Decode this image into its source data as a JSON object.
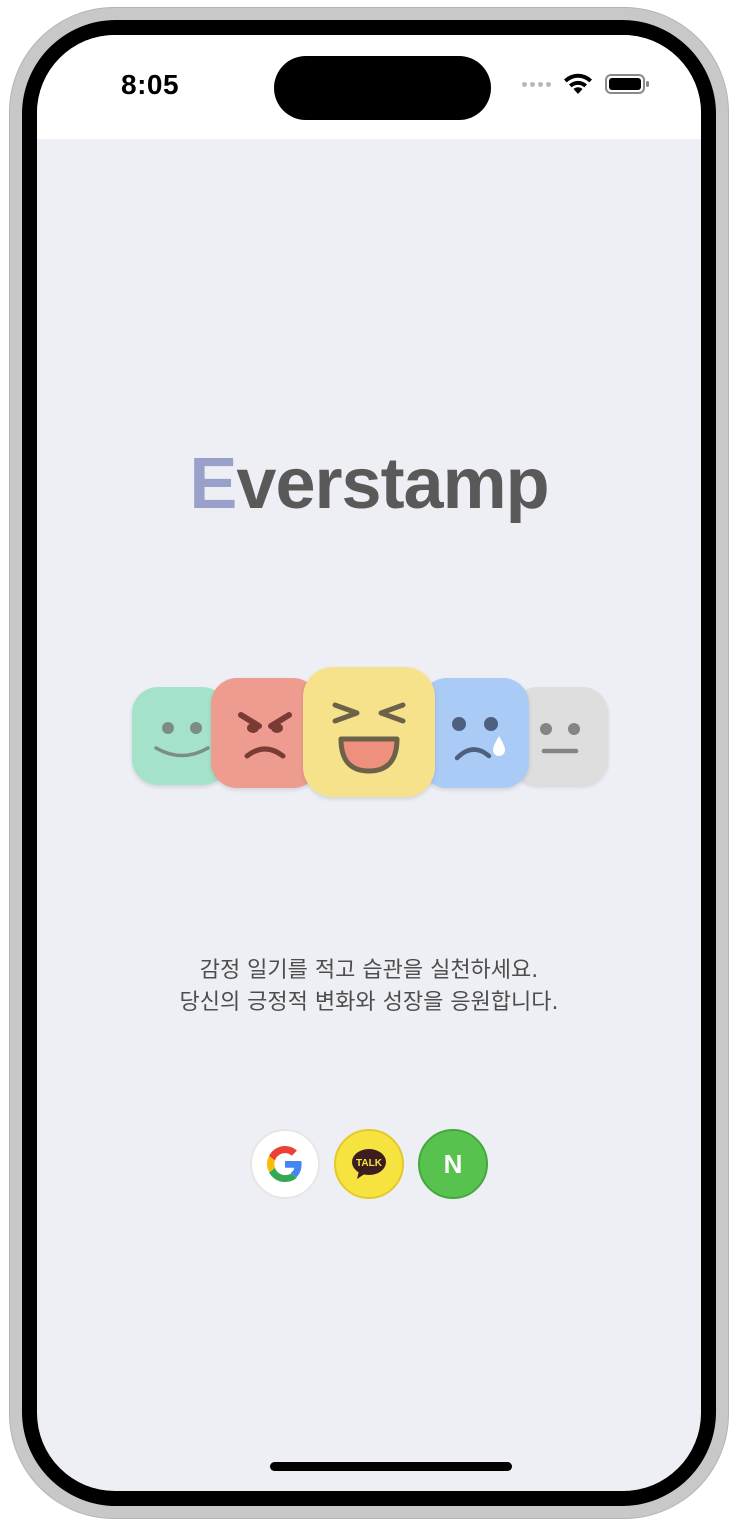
{
  "status_bar": {
    "time": "8:05",
    "icons": [
      "cellular-signal-icon",
      "wifi-icon",
      "battery-icon"
    ]
  },
  "app": {
    "title_first_letter": "E",
    "title_rest": "verstamp",
    "title_accent_color": "#99a0c9",
    "title_color": "#595959"
  },
  "emotions": [
    {
      "name": "happy",
      "color": "#a4e3c9"
    },
    {
      "name": "angry",
      "color": "#ef9c90"
    },
    {
      "name": "joyful",
      "color": "#f7e28c"
    },
    {
      "name": "sad",
      "color": "#a9cbf5"
    },
    {
      "name": "neutral",
      "color": "#dedede"
    }
  ],
  "tagline": {
    "line1": "감정 일기를 적고 습관을 실천하세요.",
    "line2": "당신의 긍정적 변화와 성장을 응원합니다."
  },
  "login": {
    "google": {
      "icon": "google-logo-icon",
      "color": "#ffffff"
    },
    "kakao": {
      "icon": "kakao-talk-icon",
      "badge_text": "TALK",
      "color": "#f6e33f"
    },
    "naver": {
      "icon": "naver-logo-icon",
      "letter": "N",
      "color": "#58c24f"
    }
  }
}
